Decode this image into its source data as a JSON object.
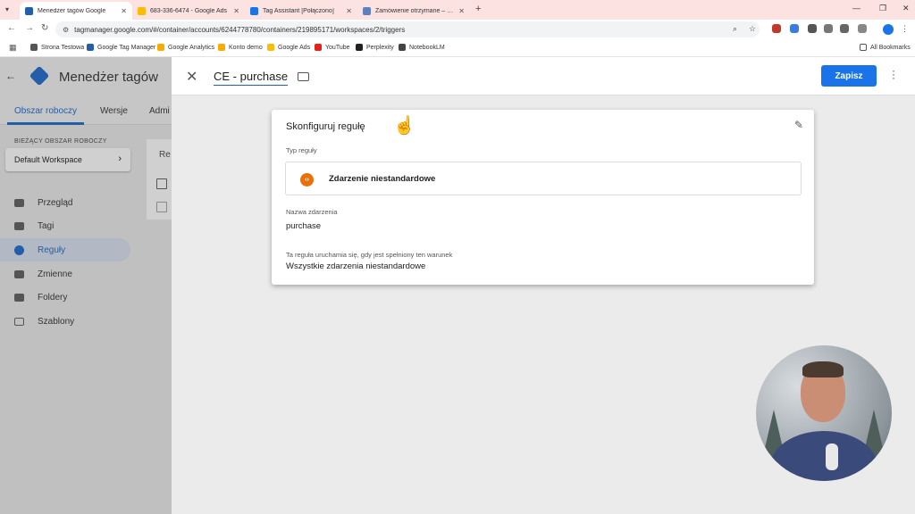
{
  "browser": {
    "tabs": [
      {
        "label": "Menedżer tagów Google",
        "active": true,
        "color": "#245ea8"
      },
      {
        "label": "683-336-6474 - Google Ads",
        "active": false,
        "color": "#fbbc04"
      },
      {
        "label": "Tag Assistant [Połączono]",
        "active": false,
        "color": "#1a73e8"
      },
      {
        "label": "Zamówienie otrzymane – Stron",
        "active": false,
        "color": "#5f7fbf"
      }
    ],
    "url": "tagmanager.google.com/#/container/accounts/6244778780/containers/219895171/workspaces/2/triggers",
    "bookmarks": [
      "Strona Testowa",
      "Google Tag Manager",
      "Google Analytics",
      "Konto demo",
      "Google Ads",
      "YouTube",
      "Perplexity",
      "NotebookLM"
    ],
    "all_bookmarks": "All Bookmarks"
  },
  "gtm": {
    "title": "Menedżer tagów",
    "nav_tabs": [
      "Obszar roboczy",
      "Wersje",
      "Admi"
    ],
    "workspace_caption": "BIEŻĄCY OBSZAR ROBOCZY",
    "workspace_name": "Default Workspace",
    "sidebar": [
      "Przegląd",
      "Tagi",
      "Reguły",
      "Zmienne",
      "Foldery",
      "Szablony"
    ],
    "active_sidebar": "Reguły",
    "bg_card_text": "Re"
  },
  "editor": {
    "trigger_name": "CE - purchase",
    "save_label": "Zapisz",
    "card_title": "Skonfiguruj regułę",
    "type_label": "Typ reguły",
    "type_value": "Zdarzenie niestandardowe",
    "type_icon_glyph": "‹›",
    "event_label": "Nazwa zdarzenia",
    "event_value": "purchase",
    "fires_label": "Ta reguła uruchamia się, gdy jest spełniony ten warunek",
    "fires_value": "Wszystkie zdarzenia niestandardowe"
  },
  "colors": {
    "primary": "#1a73e8",
    "gtm_blue": "#245ea8",
    "custom_event_orange": "#e8710a"
  }
}
